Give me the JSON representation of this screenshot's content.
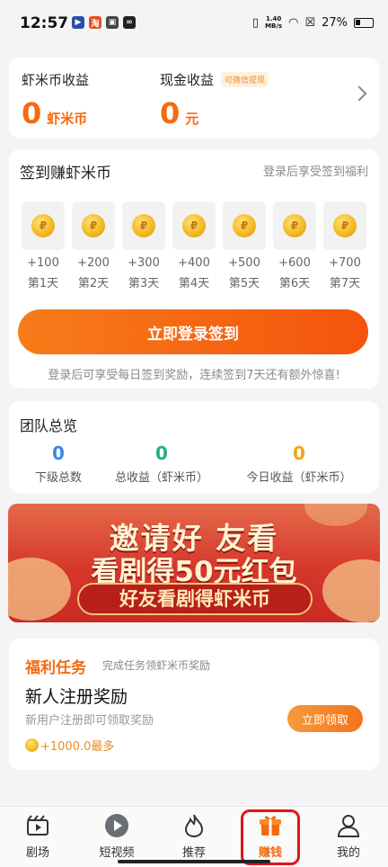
{
  "status_bar": {
    "time": "12:57",
    "net_speed_value": "1.40",
    "net_speed_unit": "MB/s",
    "battery": "27%"
  },
  "earnings": {
    "shrimp_label": "虾米币收益",
    "shrimp_value": "0",
    "shrimp_unit": "虾米币",
    "cash_label": "现金收益",
    "cash_badge": "可微信提现",
    "cash_value": "0",
    "cash_unit": "元"
  },
  "signin": {
    "title": "签到赚虾米币",
    "hint": "登录后享受签到福利",
    "days": [
      {
        "reward": "+100",
        "day": "第1天"
      },
      {
        "reward": "+200",
        "day": "第2天"
      },
      {
        "reward": "+300",
        "day": "第3天"
      },
      {
        "reward": "+400",
        "day": "第4天"
      },
      {
        "reward": "+500",
        "day": "第5天"
      },
      {
        "reward": "+600",
        "day": "第6天"
      },
      {
        "reward": "+700",
        "day": "第7天"
      }
    ],
    "button": "立即登录签到",
    "note": "登录后可享受每日签到奖励，连续签到7天还有额外惊喜!"
  },
  "team": {
    "title": "团队总览",
    "stats": [
      {
        "value": "0",
        "label": "下级总数",
        "color": "#3a86e8"
      },
      {
        "value": "0",
        "label": "总收益（虾米币）",
        "color": "#20b27a"
      },
      {
        "value": "0",
        "label": "今日收益（虾米币）",
        "color": "#f2a21b"
      }
    ]
  },
  "banner": {
    "line1": "邀请好 友看",
    "line2": "看剧得50元红包",
    "line3": "好友看剧得虾米币"
  },
  "tasks": {
    "title": "福利任务",
    "subtitle": "完成任务领虾米币奖励",
    "item_name": "新人注册奖励",
    "item_desc": "新用户注册即可领取奖励",
    "item_reward": "+1000.0最多",
    "claim_button": "立即领取"
  },
  "tabbar": {
    "items": [
      {
        "label": "剧场",
        "icon": "theater-icon"
      },
      {
        "label": "短视频",
        "icon": "play-icon"
      },
      {
        "label": "推荐",
        "icon": "flame-icon"
      },
      {
        "label": "赚钱",
        "icon": "gift-icon"
      },
      {
        "label": "我的",
        "icon": "person-icon"
      }
    ],
    "active_index": 3
  },
  "colors": {
    "accent": "#f56a0e",
    "highlight_box": "#e0161a"
  }
}
